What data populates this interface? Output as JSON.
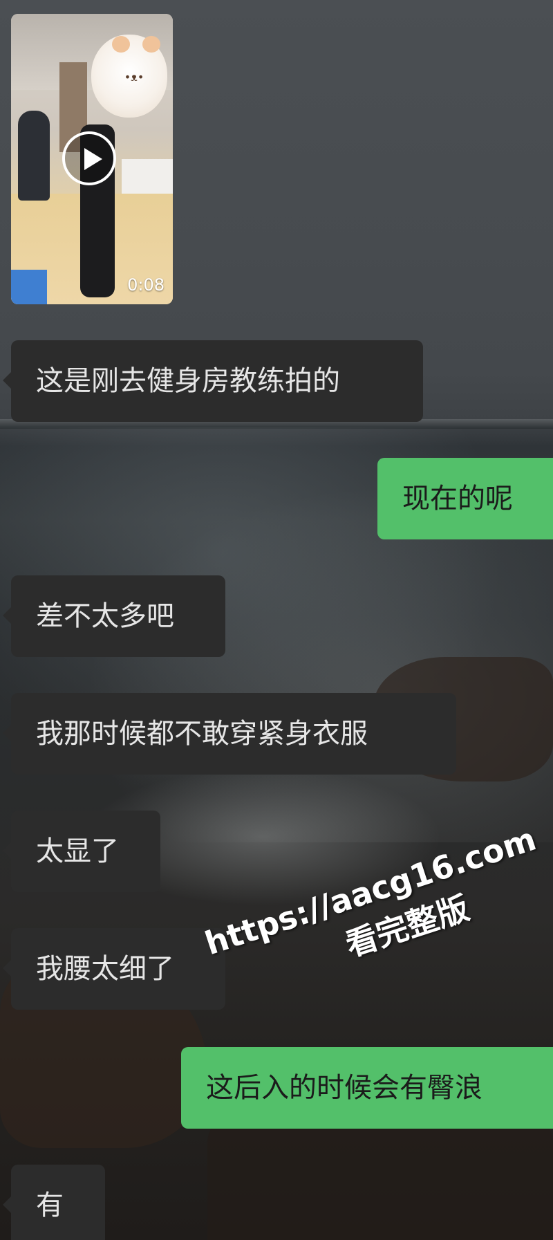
{
  "video": {
    "duration": "0:08",
    "icon": "play-icon"
  },
  "messages": [
    {
      "side": "in",
      "text": "这是刚去健身房教练拍的"
    },
    {
      "side": "out",
      "text": "现在的呢"
    },
    {
      "side": "in",
      "text": "差不太多吧"
    },
    {
      "side": "in",
      "text": "我那时候都不敢穿紧身衣服"
    },
    {
      "side": "in",
      "text": "太显了"
    },
    {
      "side": "in",
      "text": "我腰太细了"
    },
    {
      "side": "out",
      "text": "这后入的时候会有臀浪"
    },
    {
      "side": "in",
      "text": "有"
    }
  ],
  "watermark": {
    "url": "https://aacg16.com",
    "subtitle": "看完整版"
  },
  "colors": {
    "incoming_bubble": "#2c2c2c",
    "outgoing_bubble": "#53c06a",
    "incoming_text": "#e6e6e6",
    "outgoing_text": "#1b1b1b"
  }
}
